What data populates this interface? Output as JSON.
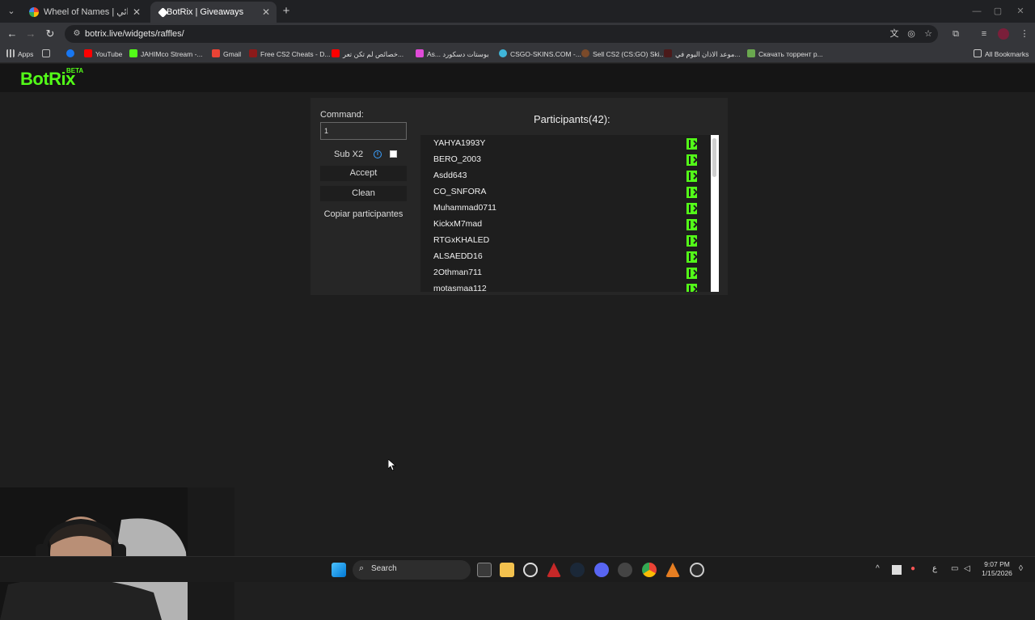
{
  "browser": {
    "tabs": [
      {
        "title": "Wheel of Names | اسم العشوائي",
        "active": false
      },
      {
        "title": "BotRix | Giveaways",
        "active": true
      }
    ],
    "url": "botrix.live/widgets/raffles/",
    "bookmarks": [
      "Apps",
      "YouTube",
      "JAHIMco Stream -...",
      "Gmail",
      "Free CS2 Cheats - D...",
      "خصائص لم تكن تعر...",
      "As... بوستات دسكورد",
      "CSGO-SKINS.COM -...",
      "Sell CS2 (CS:GO) Ski...",
      "موعد الاذان اليوم في...",
      "Скачать торрент р...",
      "All Bookmarks"
    ]
  },
  "site": {
    "logo": "BotRix",
    "beta": "BETA"
  },
  "widget": {
    "command_label": "Command:",
    "command_value": "1",
    "subx2_label": "Sub X2",
    "subx2_checked": false,
    "accept_label": "Accept",
    "clean_label": "Clean",
    "copy_label": "Copiar participantes",
    "participants_title": "Participants(42):",
    "participants": [
      "YAHYA1993Y",
      "BERO_2003",
      "Asdd643",
      "CO_SNFORA",
      "Muhammad0711",
      "KickxM7mad",
      "RTGxKHALED",
      "ALSAEDD16",
      "2Othman711",
      "motasmaa112"
    ],
    "platform_color": "#53fc18"
  },
  "taskbar": {
    "search_label": "Search",
    "time": "9:07 PM",
    "date": "1/15/2026",
    "lang": "ع"
  }
}
